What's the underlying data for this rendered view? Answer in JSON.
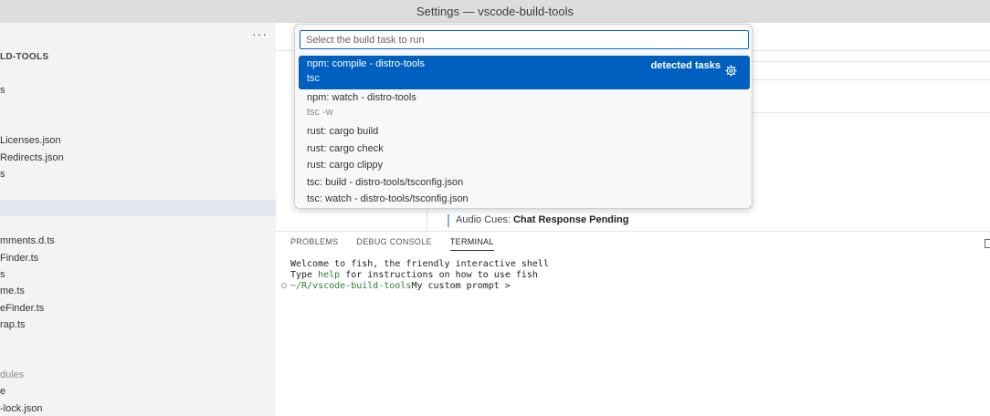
{
  "window": {
    "title": "Settings — vscode-build-tools"
  },
  "sidebar": {
    "more_label": "···",
    "root_label": "LD-TOOLS",
    "items": [
      {
        "label": "s",
        "dim": false
      },
      {
        "label": "Licenses.json",
        "dim": false
      },
      {
        "label": "Redirects.json",
        "dim": false
      },
      {
        "label": "s",
        "dim": false
      },
      {
        "label": "mments.d.ts",
        "dim": false
      },
      {
        "label": "Finder.ts",
        "dim": false
      },
      {
        "label": "s",
        "dim": false
      },
      {
        "label": "me.ts",
        "dim": false
      },
      {
        "label": "eFinder.ts",
        "dim": false
      },
      {
        "label": "rap.ts",
        "dim": false
      },
      {
        "label": "dules",
        "dim": true
      },
      {
        "label": "e",
        "dim": false
      },
      {
        "label": "-lock.json",
        "dim": false
      }
    ]
  },
  "editor": {
    "setting_prefix": "Audio Cues: ",
    "setting_name": "Chat Response Pending"
  },
  "quick_pick": {
    "placeholder": "Select the build task to run",
    "items": [
      {
        "label": "npm: compile - distro-tools",
        "detail": "tsc",
        "description": "detected tasks",
        "selected": true
      },
      {
        "label": "npm: watch - distro-tools",
        "detail": "tsc -w"
      },
      {
        "label": "rust: cargo build"
      },
      {
        "label": "rust: cargo check"
      },
      {
        "label": "rust: cargo clippy"
      },
      {
        "label": "tsc: build - distro-tools/tsconfig.json"
      },
      {
        "label": "tsc: watch - distro-tools/tsconfig.json"
      }
    ]
  },
  "panel": {
    "tabs": [
      "PROBLEMS",
      "DEBUG CONSOLE",
      "TERMINAL"
    ],
    "active_tab": "TERMINAL",
    "terminal": {
      "line1": "Welcome to fish, the friendly interactive shell",
      "line2_a": "Type ",
      "line2_help": "help",
      "line2_b": " for instructions on how to use fish",
      "prompt_path": "~/R/vscode-build-tools",
      "prompt_text": "My custom prompt >"
    }
  },
  "colors": {
    "accent": "#0060c0",
    "titlebar": "#dddddd",
    "sidebar": "#f3f3f3"
  }
}
